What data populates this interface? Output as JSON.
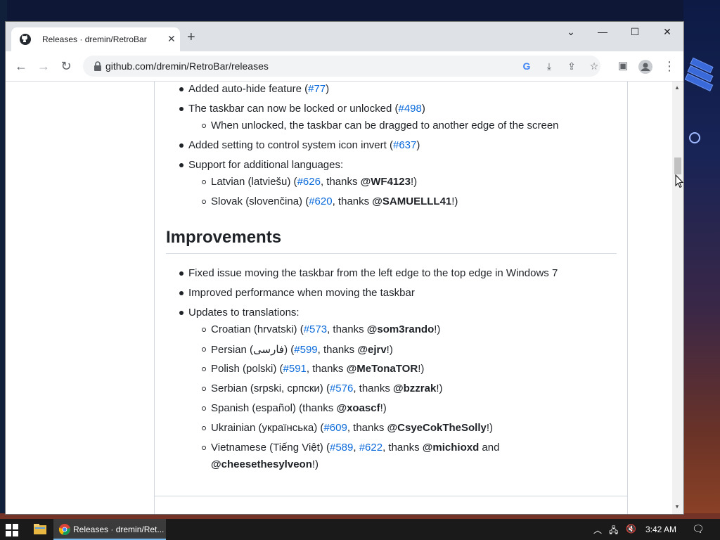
{
  "tab": {
    "title": "Releases · dremin/RetroBar",
    "close": "✕",
    "new_tab": "+"
  },
  "window_controls": {
    "dropdown": "⌄",
    "minimize": "—",
    "maximize": "☐",
    "close": "✕"
  },
  "address_bar": {
    "url": "github.com/dremin/RetroBar/releases"
  },
  "release_notes": {
    "items_top": [
      {
        "text_before": "Added auto-hide feature (",
        "link": "#77",
        "text_after": ")"
      },
      {
        "text_before": "The taskbar can now be locked or unlocked (",
        "link": "#498",
        "text_after": ")"
      },
      {
        "sub": "When unlocked, the taskbar can be dragged to another edge of the screen"
      },
      {
        "text_before": "Added setting to control system icon invert (",
        "link": "#637",
        "text_after": ")"
      },
      {
        "text": "Support for additional languages:"
      },
      {
        "lang": "Latvian (latviešu) (",
        "link": "#626",
        "mid": ", thanks ",
        "user": "@WF4123",
        "end": "!)"
      },
      {
        "lang": "Slovak (slovenčina) (",
        "link": "#620",
        "mid": ", thanks ",
        "user": "@SAMUELLL41",
        "end": "!)"
      }
    ],
    "improvements_heading": "Improvements",
    "improvements": [
      "Fixed issue moving the taskbar from the left edge to the top edge in Windows 7",
      "Improved performance when moving the taskbar",
      "Updates to translations:"
    ],
    "translations": [
      {
        "lang": "Croatian (hrvatski) (",
        "link": "#573",
        "mid": ", thanks ",
        "user": "@som3rando",
        "end": "!)"
      },
      {
        "lang": "Persian (فارسی) (",
        "link": "#599",
        "mid": ", thanks ",
        "user": "@ejrv",
        "end": "!)"
      },
      {
        "lang": "Polish (polski) (",
        "link": "#591",
        "mid": ", thanks ",
        "user": "@MeTonaTOR",
        "end": "!)"
      },
      {
        "lang": "Serbian (srpski, српски) (",
        "link": "#576",
        "mid": ", thanks ",
        "user": "@bzzrak",
        "end": "!)"
      },
      {
        "lang": "Spanish (español) (thanks ",
        "link": "",
        "mid": "",
        "user": "@xoascf",
        "end": "!)"
      },
      {
        "lang": "Ukrainian (українська) (",
        "link": "#609",
        "mid": ", thanks ",
        "user": "@CsyeCokTheSolly",
        "end": "!)"
      }
    ],
    "vietnamese": {
      "lang": "Vietnamese (Tiếng Việt) (",
      "link1": "#589",
      "sep": ", ",
      "link2": "#622",
      "mid": ", thanks ",
      "user1": "@michioxd",
      "and": " and",
      "user2": "@cheesethesylveon",
      "end": "!)"
    }
  },
  "taskbar": {
    "chrome_label": "Releases · dremin/Ret...",
    "clock": "3:42 AM"
  },
  "colors": {
    "link": "#0969da",
    "text": "#1f2328",
    "tabstrip": "#dee1e6"
  }
}
